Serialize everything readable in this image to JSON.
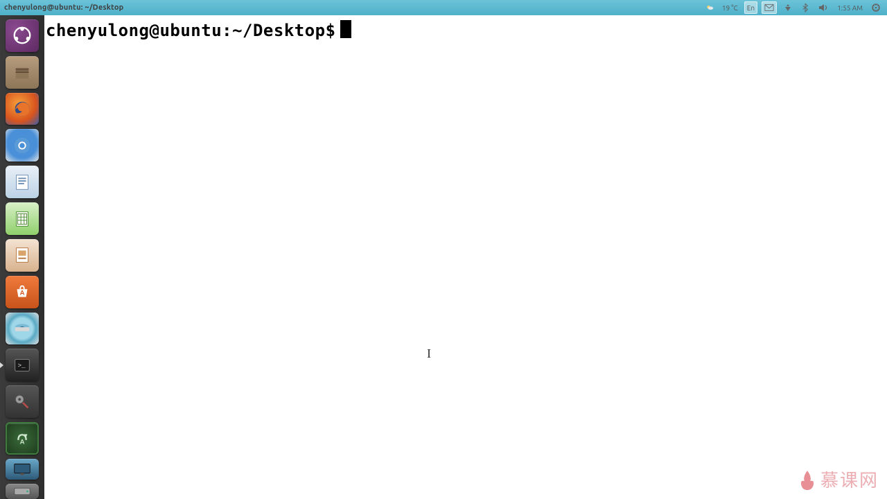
{
  "top_panel": {
    "window_title": "chenyulong@ubuntu: ~/Desktop",
    "weather_temp": "19 °C",
    "input_method": "En",
    "clock": "1:55 AM"
  },
  "launcher": {
    "items": [
      {
        "name": "dash-home",
        "label": "Dash Home"
      },
      {
        "name": "files",
        "label": "Files"
      },
      {
        "name": "firefox",
        "label": "Firefox Web Browser"
      },
      {
        "name": "chromium",
        "label": "Chromium Web Browser"
      },
      {
        "name": "libreoffice-writer",
        "label": "LibreOffice Writer"
      },
      {
        "name": "libreoffice-calc",
        "label": "LibreOffice Calc"
      },
      {
        "name": "libreoffice-impress",
        "label": "LibreOffice Impress"
      },
      {
        "name": "software-center",
        "label": "Ubuntu Software Center"
      },
      {
        "name": "disc-app",
        "label": "Disc Utility"
      },
      {
        "name": "terminal",
        "label": "Terminal",
        "active": true
      },
      {
        "name": "system-settings",
        "label": "System Settings"
      },
      {
        "name": "software-updater",
        "label": "Software Updater"
      },
      {
        "name": "workspace-switcher",
        "label": "Workspace Switcher"
      },
      {
        "name": "mounted-drive",
        "label": "Mounted Drive"
      }
    ]
  },
  "terminal": {
    "prompt": "chenyulong@ubuntu:~/Desktop$",
    "input": ""
  },
  "watermark": {
    "text": "慕课网"
  },
  "tray_icons": {
    "weather": "weather-icon",
    "mail": "mail-icon",
    "network": "network-icon",
    "bluetooth": "bluetooth-icon",
    "sound": "sound-icon",
    "power": "power-icon"
  }
}
